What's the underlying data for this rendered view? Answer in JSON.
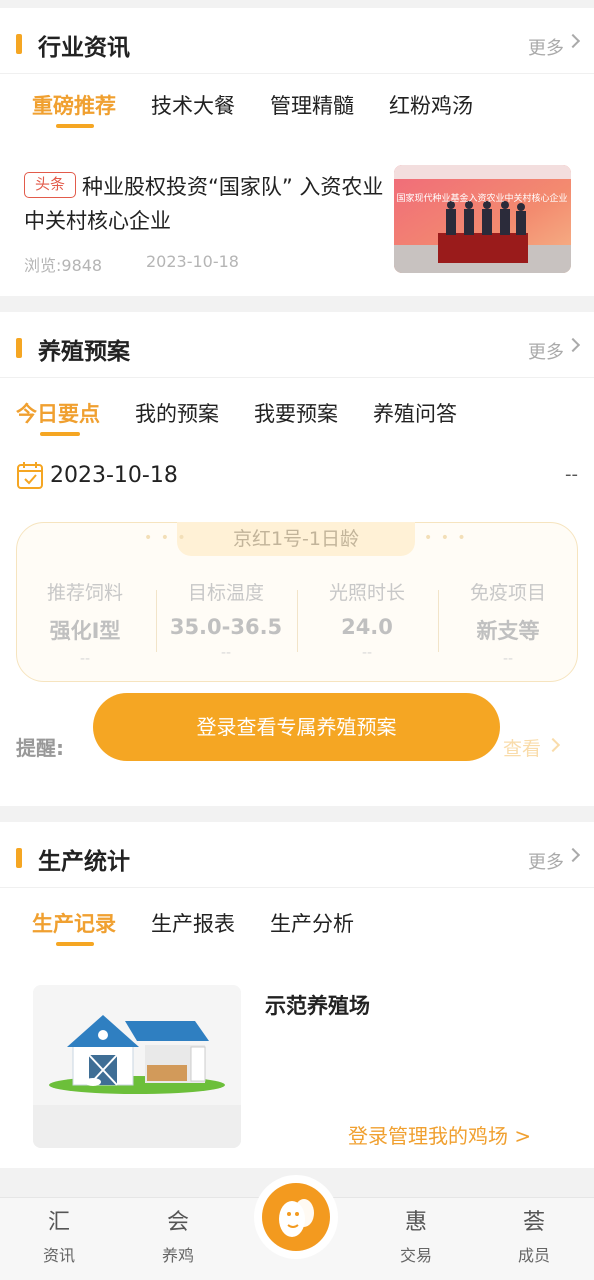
{
  "industry_news": {
    "title": "行业资讯",
    "more": "更多",
    "tabs": [
      "重磅推荐",
      "技术大餐",
      "管理精髓",
      "红粉鸡汤"
    ],
    "article": {
      "tag": "头条",
      "headline": "种业股权投资“国家队” 入资农业中关村核心企业",
      "views": "浏览:9848",
      "date": "2023-10-18",
      "image_banner": "国家现代种业基金入资农业中关村核心企业"
    }
  },
  "breeding_plan": {
    "title": "养殖预案",
    "more": "更多",
    "tabs": [
      "今日要点",
      "我的预案",
      "我要预案",
      "养殖问答"
    ],
    "date": "2023-10-18",
    "date_suffix": "--",
    "breed_info": "京红1号-1日龄",
    "dots": "• • •",
    "items": [
      {
        "label": "推荐饲料",
        "value": "强化I型",
        "sub": "--"
      },
      {
        "label": "目标温度",
        "value": "35.0-36.5",
        "sub": "--"
      },
      {
        "label": "光照时长",
        "value": "24.0",
        "sub": "--"
      },
      {
        "label": "免疫项目",
        "value": "新支等",
        "sub": "--"
      }
    ],
    "remind_label": "提醒:",
    "login_button": "登录查看专属养殖预案",
    "view_link": "查看"
  },
  "production": {
    "title": "生产统计",
    "more": "更多",
    "tabs": [
      "生产记录",
      "生产报表",
      "生产分析"
    ],
    "farm_name": "示范养殖场",
    "login_link": "登录管理我的鸡场 >"
  },
  "bottom_nav": {
    "items": [
      {
        "label": "资讯",
        "icon": "汇"
      },
      {
        "label": "养鸡",
        "icon": "会"
      },
      {
        "label": "交易",
        "icon": "惠"
      },
      {
        "label": "成员",
        "icon": "荟"
      }
    ]
  },
  "colors": {
    "accent": "#f5a623",
    "tag_red": "#e25b4b"
  }
}
